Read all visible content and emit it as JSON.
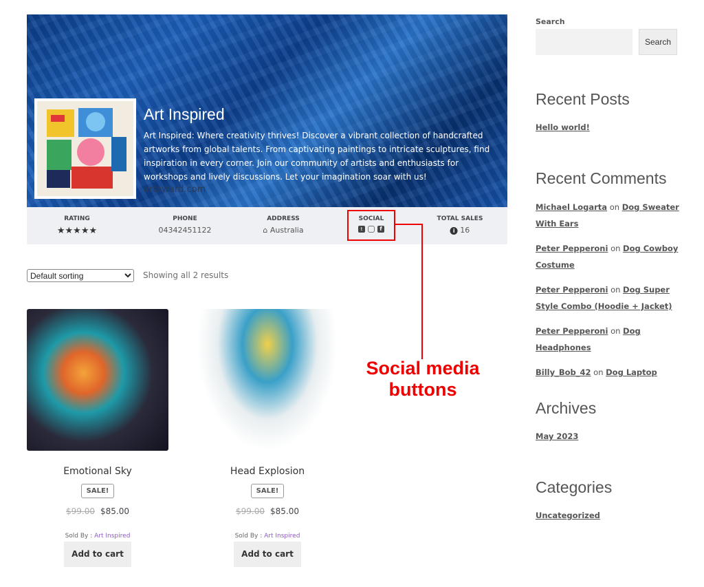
{
  "store": {
    "name": "Art Inspired",
    "description": "Art Inspired: Where creativity thrives! Discover a vibrant collection of handcrafted artworks from global talents. From captivating paintings to intricate sculptures, find inspiration in every corner. Join our community of artists and enthusiasts for workshops and lively discussions. Let your imagination soar with us!",
    "watermark": "artaward.com"
  },
  "info": {
    "rating_label": "RATING",
    "rating_value": 5,
    "rating_stars": "★★★★★",
    "phone_label": "PHONE",
    "phone": "04342451122",
    "address_label": "ADDRESS",
    "address": "Australia",
    "social_label": "SOCIAL",
    "social_icons": [
      "twitter-icon",
      "instagram-icon",
      "facebook-icon"
    ],
    "sales_label": "TOTAL SALES",
    "sales": "16"
  },
  "annotation": {
    "text": "Social media buttons",
    "color": "#e00000"
  },
  "shop": {
    "sorting": "Default sorting",
    "result_count": "Showing all 2 results"
  },
  "products": [
    {
      "title": "Emotional Sky",
      "badge": "SALE!",
      "old_price": "$99.00",
      "price": "$85.00",
      "sold_by_label": "Sold By :",
      "vendor": "Art Inspired",
      "button": "Add to cart"
    },
    {
      "title": "Head Explosion",
      "badge": "SALE!",
      "old_price": "$99.00",
      "price": "$85.00",
      "sold_by_label": "Sold By :",
      "vendor": "Art Inspired",
      "button": "Add to cart"
    }
  ],
  "sidebar": {
    "search_label": "Search",
    "search_placeholder": "",
    "search_button": "Search",
    "recent_posts_title": "Recent Posts",
    "recent_posts": [
      "Hello world!"
    ],
    "recent_comments_title": "Recent Comments",
    "comments": [
      {
        "author": "Michael Logarta",
        "on": "on",
        "post": "Dog Sweater With Ears"
      },
      {
        "author": "Peter Pepperoni",
        "on": "on",
        "post": "Dog Cowboy Costume"
      },
      {
        "author": "Peter Pepperoni",
        "on": "on",
        "post": "Dog Super Style Combo (Hoodie + Jacket)"
      },
      {
        "author": "Peter Pepperoni",
        "on": "on",
        "post": "Dog Headphones"
      },
      {
        "author": "Billy_Bob_42",
        "on": "on",
        "post": "Dog Laptop"
      }
    ],
    "archives_title": "Archives",
    "archives": [
      "May 2023"
    ],
    "categories_title": "Categories",
    "categories": [
      "Uncategorized"
    ]
  }
}
